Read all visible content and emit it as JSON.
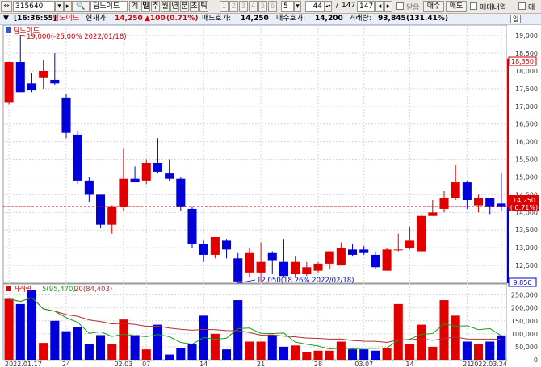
{
  "toolbar": {
    "code": "315640",
    "name": "딥노이드",
    "period_tabs": [
      "계",
      "일",
      "주",
      "월",
      "년",
      "분",
      "초",
      "틱"
    ],
    "active_period": "일",
    "intervals": [
      "1",
      "2",
      "3",
      "4",
      "5",
      "6"
    ],
    "interval_select": "5",
    "count": "44",
    "count_of": "147",
    "count_total": "147",
    "close_label": "닫음",
    "buy_label": "매수",
    "sell_label": "매도",
    "trade_history_label": "매매내역",
    "extra_label": "매"
  },
  "infobar": {
    "time": "[16:36:55]",
    "name": "딥노이드",
    "current_price_label": "현재가:",
    "current_price": "14,250",
    "change": "▲100",
    "change_pct": "(0.71%)",
    "ask_label": "매도호가:",
    "ask": "14,250",
    "bid_label": "매수호가:",
    "bid": "14,200",
    "volume_label": "거래량:",
    "volume": "93,845",
    "volume_pct": "(131.41%)",
    "scale_button": "일"
  },
  "price_panel": {
    "legend_name": "딥노이드",
    "max_annotation": "19,000(-25.00% 2022/01/18)",
    "min_annotation": "12,050(18.26% 2022/02/18)",
    "current_tag_price": "14,250",
    "current_tag_pct": "( 0.71%)",
    "top_tag": "18,350",
    "bottom_tag": "9,850",
    "y_ticks": [
      "19,000",
      "18,500",
      "18,000",
      "17,500",
      "17,000",
      "16,500",
      "16,000",
      "15,500",
      "15,000",
      "14,500",
      "14,000",
      "13,500",
      "13,000",
      "12,500"
    ]
  },
  "volume_panel": {
    "legend_label": "거래량",
    "ma5_label": "5(95,470)",
    "ma20_label": "20(84,403)",
    "y_ticks": [
      "250,000",
      "200,000",
      "150,000",
      "100,000",
      "50,000",
      "0"
    ]
  },
  "x_labels": [
    "2022.01.17",
    "24",
    "02.03",
    "07",
    "14",
    "21",
    "28",
    "03.07",
    "14",
    "21",
    "2022.03.24"
  ],
  "colors": {
    "up": "#e00000",
    "down": "#0000d8",
    "ma5": "#1a9c1a",
    "ma20": "#b03030",
    "grid": "#d6d6d6"
  },
  "chart_data": {
    "type": "candlestick",
    "dates": [
      "2022.01.17",
      "01.18",
      "01.19",
      "01.20",
      "01.21",
      "01.24",
      "01.25",
      "01.26",
      "01.27",
      "01.28",
      "02.03",
      "02.04",
      "02.07",
      "02.08",
      "02.09",
      "02.10",
      "02.11",
      "02.14",
      "02.15",
      "02.16",
      "02.17",
      "02.18",
      "02.21",
      "02.22",
      "02.23",
      "02.24",
      "02.25",
      "02.28",
      "03.02",
      "03.03",
      "03.04",
      "03.07",
      "03.08",
      "03.10",
      "03.11",
      "03.14",
      "03.15",
      "03.16",
      "03.17",
      "03.18",
      "03.21",
      "03.22",
      "03.23",
      "2022.03.24"
    ],
    "open": [
      17100,
      18250,
      17650,
      17800,
      17750,
      17250,
      16200,
      14900,
      14500,
      13650,
      14150,
      14950,
      14900,
      15400,
      15100,
      14950,
      14100,
      13100,
      12800,
      13200,
      12700,
      12300,
      12300,
      12850,
      12600,
      12250,
      12250,
      12350,
      12550,
      12500,
      12950,
      12950,
      12800,
      12350,
      12950,
      13000,
      12900,
      13900,
      14100,
      14400,
      14850,
      14200,
      14400,
      14250
    ],
    "close": [
      18250,
      17400,
      17450,
      18000,
      17650,
      16250,
      14900,
      14500,
      13650,
      14150,
      14950,
      14850,
      15400,
      15150,
      14950,
      14150,
      13100,
      12800,
      13300,
      12950,
      12050,
      12850,
      12600,
      12650,
      12200,
      12600,
      12450,
      12550,
      12900,
      13000,
      12800,
      12850,
      12450,
      12950,
      12950,
      13200,
      13900,
      14000,
      14400,
      14850,
      14350,
      14400,
      14150,
      14150
    ],
    "high": [
      18250,
      19000,
      17950,
      18300,
      18500,
      17350,
      16300,
      15000,
      14500,
      14200,
      15800,
      15300,
      15500,
      16100,
      15500,
      15000,
      14150,
      13200,
      13100,
      13250,
      12850,
      13000,
      13150,
      12900,
      13250,
      12750,
      12600,
      12600,
      12900,
      13150,
      13100,
      13050,
      12900,
      13000,
      13400,
      13600,
      14000,
      14350,
      14600,
      15350,
      14900,
      14500,
      14400,
      15100
    ],
    "low": [
      17050,
      17400,
      17400,
      17500,
      17600,
      16100,
      14800,
      14300,
      13550,
      13400,
      14050,
      14850,
      14800,
      15100,
      14900,
      14050,
      13000,
      12600,
      12700,
      12700,
      12000,
      12150,
      12050,
      12250,
      12150,
      12150,
      12200,
      12300,
      12400,
      12500,
      12750,
      12800,
      12400,
      12350,
      12900,
      12950,
      12850,
      13900,
      14000,
      14350,
      14100,
      14000,
      13950,
      14050
    ],
    "volume": [
      235000,
      215000,
      270000,
      65000,
      150000,
      110000,
      125000,
      60000,
      95000,
      60000,
      155000,
      95000,
      40000,
      135000,
      20000,
      45000,
      60000,
      170000,
      100000,
      40000,
      230000,
      70000,
      70000,
      95000,
      50000,
      55000,
      30000,
      35000,
      35000,
      70000,
      40000,
      40000,
      35000,
      45000,
      215000,
      60000,
      135000,
      50000,
      230000,
      170000,
      70000,
      60000,
      70000,
      93845
    ],
    "ylim": [
      12000,
      19300
    ],
    "volume_ylim": [
      0,
      280000
    ]
  }
}
